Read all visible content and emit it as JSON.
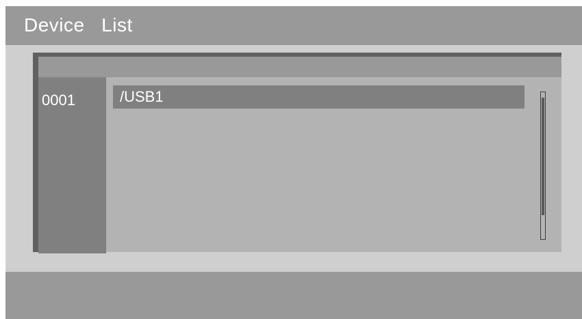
{
  "title": "Device  List",
  "device_list": {
    "rows": [
      {
        "index": "0001",
        "path": "/USB1",
        "selected": true
      }
    ],
    "scroll_fraction": 0.0
  },
  "colors": {
    "title_bar": "#999999",
    "background": "#cfcfcf",
    "selected_row": "#808080",
    "list_area": "#b3b3b3",
    "text": "#ffffff"
  }
}
